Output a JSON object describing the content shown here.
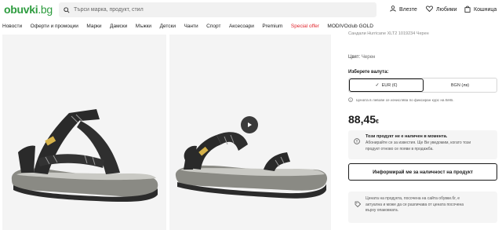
{
  "header": {
    "logo": "obuvki",
    "logo_tld": ".bg",
    "search_placeholder": "Търси марка, продукт, стил",
    "login_label": "Влезте",
    "favorites_label": "Любими",
    "cart_label": "Кошница"
  },
  "nav": {
    "items": [
      {
        "label": "Новости"
      },
      {
        "label": "Оферти и промоции"
      },
      {
        "label": "Марки"
      },
      {
        "label": "Дамски"
      },
      {
        "label": "Мъжки"
      },
      {
        "label": "Детски"
      },
      {
        "label": "Чанти"
      },
      {
        "label": "Спорт"
      },
      {
        "label": "Аксесоари"
      },
      {
        "label": "Premium"
      },
      {
        "label": "Special offer"
      },
      {
        "label": "MODIVOclub GOLD"
      }
    ]
  },
  "product": {
    "sku_line": "Сандали Hurricane XLT2 1019234 Черен",
    "color_label": "Цвят:",
    "color_value": "Черен",
    "currency_title": "Изберете валута:",
    "currency_options": [
      {
        "label": "EUR (€)",
        "active": true
      },
      {
        "label": "BGN (лв)",
        "active": false
      }
    ],
    "rate_note": "Цената в левове се изчислява по фиксиран курс на БНБ.",
    "price": "88,45",
    "price_currency": "€",
    "oos_title": "Този продукт не е наличен в момента.",
    "oos_text_1": "Абонирайте се за известия. Ще Ви уведомим, когато този",
    "oos_text_2": "продукт отново се появи в продажба.",
    "notify_button": "Информирай ме за наличност на продукт",
    "price_note_1": "Цената на продукта, посочена на сайта обувки.бг, е",
    "price_note_2": "актуална и може да се различава от цената посочена",
    "price_note_3": "върху опаковката."
  },
  "colors": {
    "brand": "#2e9c3f",
    "special": "#e0262e",
    "gallery_bg": "#f4f4f4"
  }
}
